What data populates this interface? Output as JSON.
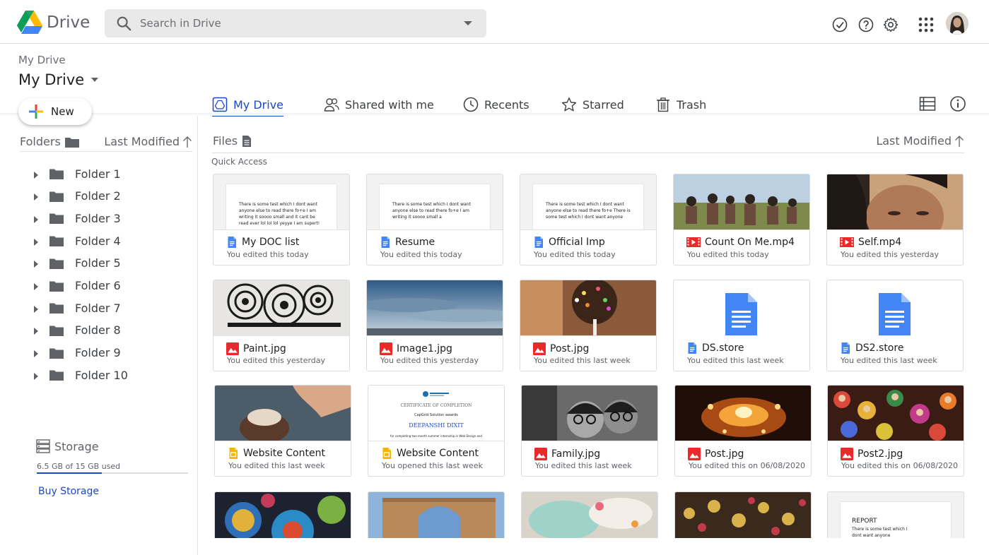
{
  "app": {
    "name": "Drive"
  },
  "search": {
    "placeholder": "Search in Drive"
  },
  "header_icons": [
    "check-circle-icon",
    "help-icon",
    "settings-icon",
    "apps-grid-icon"
  ],
  "breadcrumb": "My Drive",
  "page_title": "My Drive",
  "new_button": "New",
  "tabs": [
    {
      "label": "My Drive",
      "icon": "drive-icon",
      "active": true
    },
    {
      "label": "Shared with me",
      "icon": "people-icon",
      "active": false
    },
    {
      "label": "Recents",
      "icon": "clock-icon",
      "active": false
    },
    {
      "label": "Starred",
      "icon": "star-icon",
      "active": false
    },
    {
      "label": "Trash",
      "icon": "trash-icon",
      "active": false
    }
  ],
  "sidebar": {
    "folders_label": "Folders",
    "sort_label": "Last Modified",
    "folders": [
      "Folder 1",
      "Folder 2",
      "Folder 3",
      "Folder 4",
      "Folder 5",
      "Folder 6",
      "Folder 7",
      "Folder 8",
      "Folder 9",
      "Folder 10"
    ],
    "storage_label": "Storage",
    "storage_used": "6.5 GB of 15 GB used",
    "storage_fraction": 0.43,
    "buy_storage": "Buy Storage"
  },
  "files": {
    "label": "Files",
    "sort_label": "Last Modified",
    "quick_access": "Quick Access",
    "items": [
      {
        "name": "My DOC list",
        "sub": "You edited this today",
        "type": "doc",
        "preview": "There is some test which I dont want anyone else to read there fo+e I am writing it soooo small and it cant be read ever lol lol lol yeyye I am supert!"
      },
      {
        "name": "Resume",
        "sub": "You edited this today",
        "type": "doc",
        "preview": "There is some test which I dont want anyone else to read there fo+e I am writing it soooo small a"
      },
      {
        "name": "Official Imp",
        "sub": "You edited this today",
        "type": "doc",
        "preview": "There is some test which I dont want anyone else to read there fo+e There is some test which I dont want anyone"
      },
      {
        "name": "Count On Me.mp4",
        "sub": "You edited this today",
        "type": "video"
      },
      {
        "name": "Self.mp4",
        "sub": "You edited this yesterday",
        "type": "video"
      },
      {
        "name": "Paint.jpg",
        "sub": "You edited this yesterday",
        "type": "image"
      },
      {
        "name": "Image1.jpg",
        "sub": "You edited this yesterday",
        "type": "image"
      },
      {
        "name": "Post.jpg",
        "sub": "You edited this last week",
        "type": "image"
      },
      {
        "name": "DS.store",
        "sub": "You edited this last week",
        "type": "doc"
      },
      {
        "name": "DS2.store",
        "sub": "You edited this last week",
        "type": "doc"
      },
      {
        "name": "Website Content",
        "sub": "You edited this last week",
        "type": "slides"
      },
      {
        "name": "Website Content",
        "sub": "You opened this last week",
        "type": "slides",
        "preview": [
          "CERTIFICATE OF COMPLETION",
          "CapGrid Solution awards",
          "DEEPANSHI DIXIT",
          "for completing two month summer internship in Web Design and"
        ]
      },
      {
        "name": "Family.jpg",
        "sub": "You edited this last week",
        "type": "image"
      },
      {
        "name": "Post.jpg",
        "sub": "You edited this on 06/08/2020",
        "type": "image"
      },
      {
        "name": "Post2.jpg",
        "sub": "You edited this on 06/08/2020",
        "type": "image"
      }
    ],
    "partial_report": {
      "title": "REPORT",
      "text": "There is some test which I dont want anyone"
    }
  },
  "colors": {
    "accent": "#1a49c9",
    "doc_blue": "#4285f4",
    "image_red": "#ea2a2a",
    "slides_yellow": "#f4b400"
  }
}
